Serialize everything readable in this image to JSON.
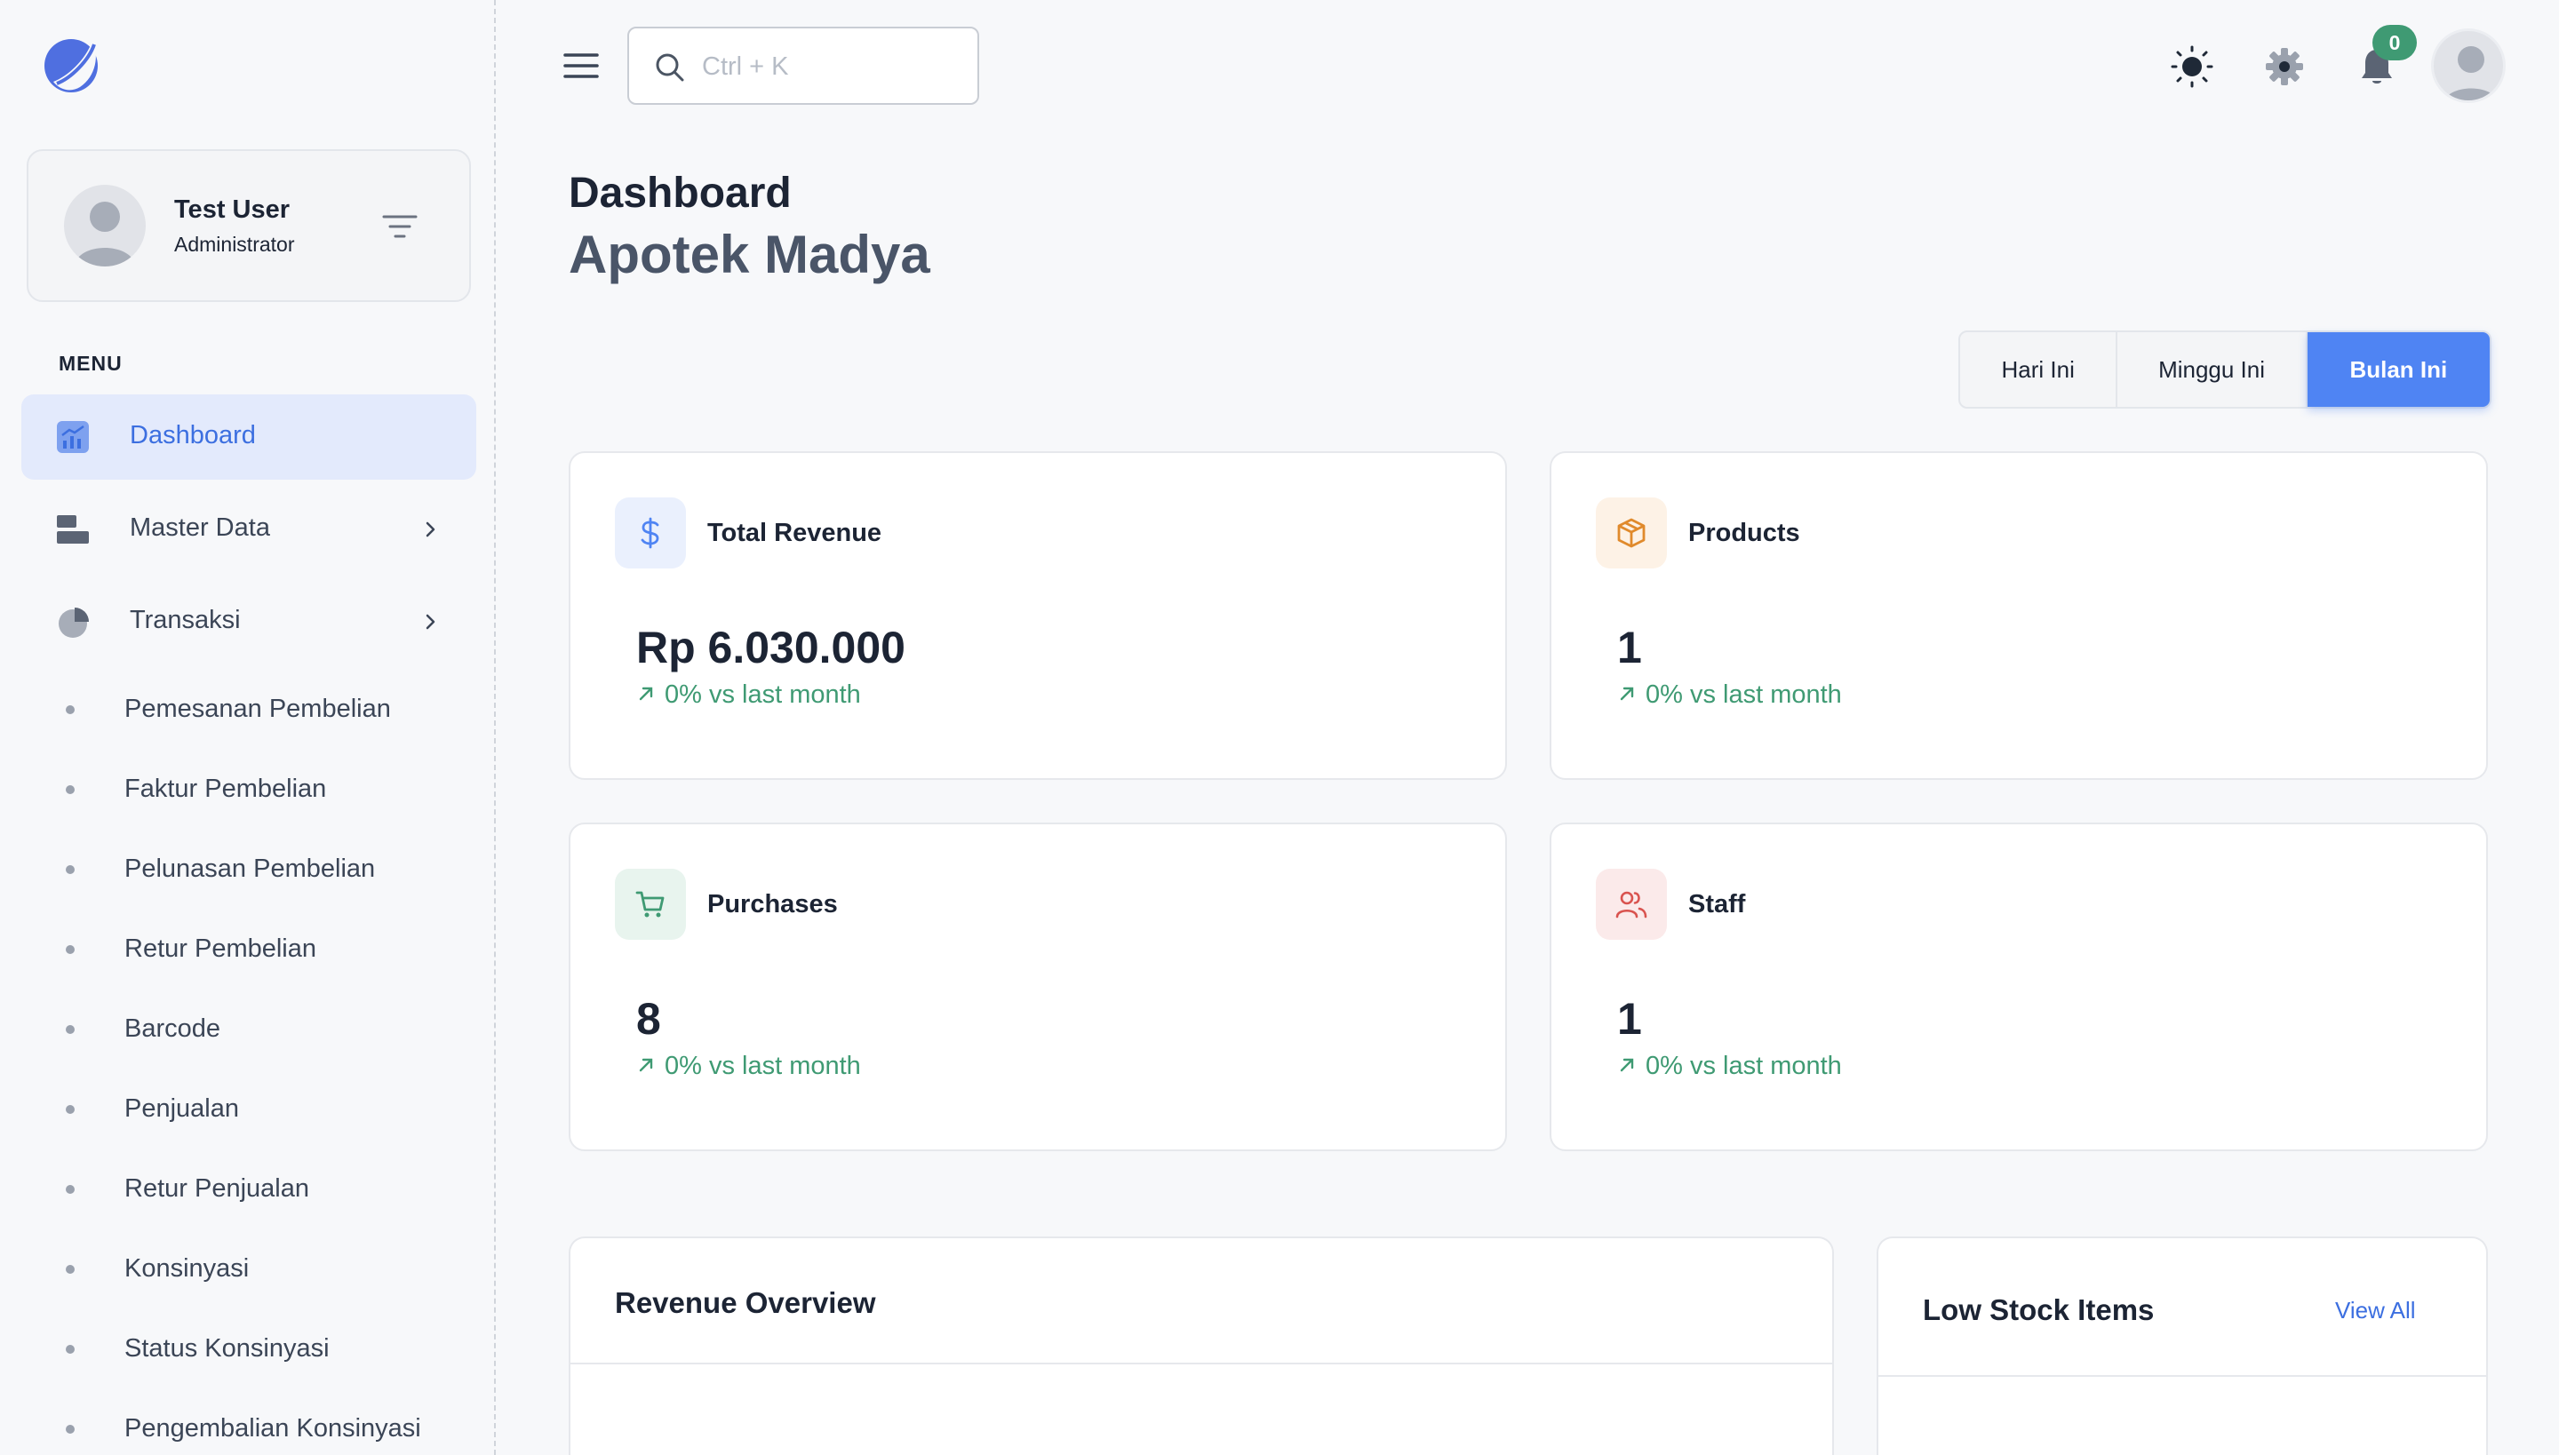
{
  "sidebar": {
    "user": {
      "name": "Test User",
      "role": "Administrator"
    },
    "menu_title": "MENU",
    "nav": [
      {
        "label": "Dashboard",
        "icon": "chart-icon",
        "active": true
      },
      {
        "label": "Master Data",
        "icon": "database-icon",
        "active": false
      },
      {
        "label": "Transaksi",
        "icon": "pie-chart-icon",
        "active": false
      }
    ],
    "sub_items": [
      "Pemesanan Pembelian",
      "Faktur Pembelian",
      "Pelunasan Pembelian",
      "Retur Pembelian",
      "Barcode",
      "Penjualan",
      "Retur Penjualan",
      "Konsinyasi",
      "Status Konsinyasi",
      "Pengembalian Konsinyasi"
    ]
  },
  "header": {
    "search_placeholder": "Ctrl + K",
    "notification_count": "0"
  },
  "page": {
    "title": "Dashboard",
    "subtitle": "Apotek Madya"
  },
  "period_tabs": [
    {
      "label": "Hari Ini",
      "active": false
    },
    {
      "label": "Minggu Ini",
      "active": false
    },
    {
      "label": "Bulan Ini",
      "active": true
    }
  ],
  "stats": [
    {
      "title": "Total Revenue",
      "value": "Rp 6.030.000",
      "trend": "0% vs last month",
      "icon": "dollar-icon",
      "color": "#4f84f3",
      "bg": "#eaf0fd"
    },
    {
      "title": "Products",
      "value": "1",
      "trend": "0% vs last month",
      "icon": "box-icon",
      "color": "#e08a2c",
      "bg": "#fdf2e6"
    },
    {
      "title": "Purchases",
      "value": "8",
      "trend": "0% vs last month",
      "icon": "cart-icon",
      "color": "#3f9a73",
      "bg": "#e8f4ee"
    },
    {
      "title": "Staff",
      "value": "1",
      "trend": "0% vs last month",
      "icon": "users-icon",
      "color": "#d9534f",
      "bg": "#fbeaea"
    }
  ],
  "panels": {
    "revenue_overview": {
      "title": "Revenue Overview"
    },
    "low_stock": {
      "title": "Low Stock Items",
      "view_all": "View All"
    }
  },
  "colors": {
    "accent": "#4f84f3",
    "success": "#3f9a73",
    "active_nav_bg": "#e3eafc"
  }
}
